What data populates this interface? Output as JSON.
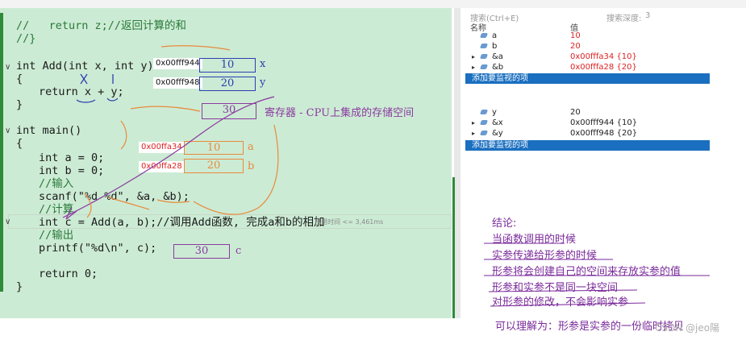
{
  "code": {
    "line1": "//   return z;//返回计算的和",
    "line2": "//}",
    "add_sig": "int Add(int x, int y)",
    "brace_open1": "{",
    "return_line": "return x + y;",
    "brace_close1": "}",
    "main_sig": "int main()",
    "brace_open2": "{",
    "decl_a": "int a = 0;",
    "decl_b": "int b = 0;",
    "cm_input": "//输入",
    "scanf": "scanf(\"%d %d\", &a, &b);",
    "cm_calc": "//计算",
    "call_line": "int c = Add(a, b);//调用Add函数, 完成a和b的相加",
    "cm_output": "//输出",
    "printf": "printf(\"%d\\n\", c);",
    "return0": "return 0;",
    "brace_close2": "}",
    "hint": "已用时间 <= 3,461ms"
  },
  "memory": {
    "x_addr": "0x00fff944",
    "x_val": "10",
    "x_lbl": "x",
    "y_addr": "0x00fff948",
    "y_val": "20",
    "y_lbl": "y",
    "reg_val": "30",
    "reg_desc": "寄存器 - CPU上集成的存储空间",
    "a_addr": "0x00ffa34",
    "a_val": "10",
    "a_lbl": "a",
    "b_addr": "0x00ffa28",
    "b_val": "20",
    "b_lbl": "b",
    "c_val": "30",
    "c_lbl": "c"
  },
  "watch": {
    "col_name": "名称",
    "col_value": "值",
    "search_label": "搜索(Ctrl+E)",
    "depth_label": "搜索深度:",
    "depth_value": "3",
    "rows1": [
      {
        "name": "a",
        "value": "10"
      },
      {
        "name": "b",
        "value": "20"
      },
      {
        "name": "&a",
        "value": "0x00fffa34 {10}"
      },
      {
        "name": "&b",
        "value": "0x00fffa28 {20}"
      }
    ],
    "add_watch1": "添加要监视的项",
    "rows2": [
      {
        "name": "y",
        "value": "20"
      },
      {
        "name": "&x",
        "value": "0x00fff944 {10}"
      },
      {
        "name": "&y",
        "value": "0x00fff948 {20}"
      }
    ],
    "add_watch2": "添加要监视的项"
  },
  "conclusion": {
    "title": "结论:",
    "l1": "当函数调用的时候",
    "l2": "实参传递给形参的时候",
    "l3": "形参将会创建自己的空间来存放实参的值",
    "l4": "形参和实参不是同一块空间",
    "l5": "对形参的修改，不会影响实参",
    "l6": "可以理解为：形参是实参的一份临时拷贝"
  },
  "watermark": "CSDN @jeo陽",
  "colors": {
    "editor_bg": "#ccebd4",
    "selection": "#1a6fc0",
    "red_value": "#d22222",
    "annot_purple": "#8a3aa0",
    "annot_orange": "#e88a3c",
    "annot_blue": "#2a3fb0"
  }
}
